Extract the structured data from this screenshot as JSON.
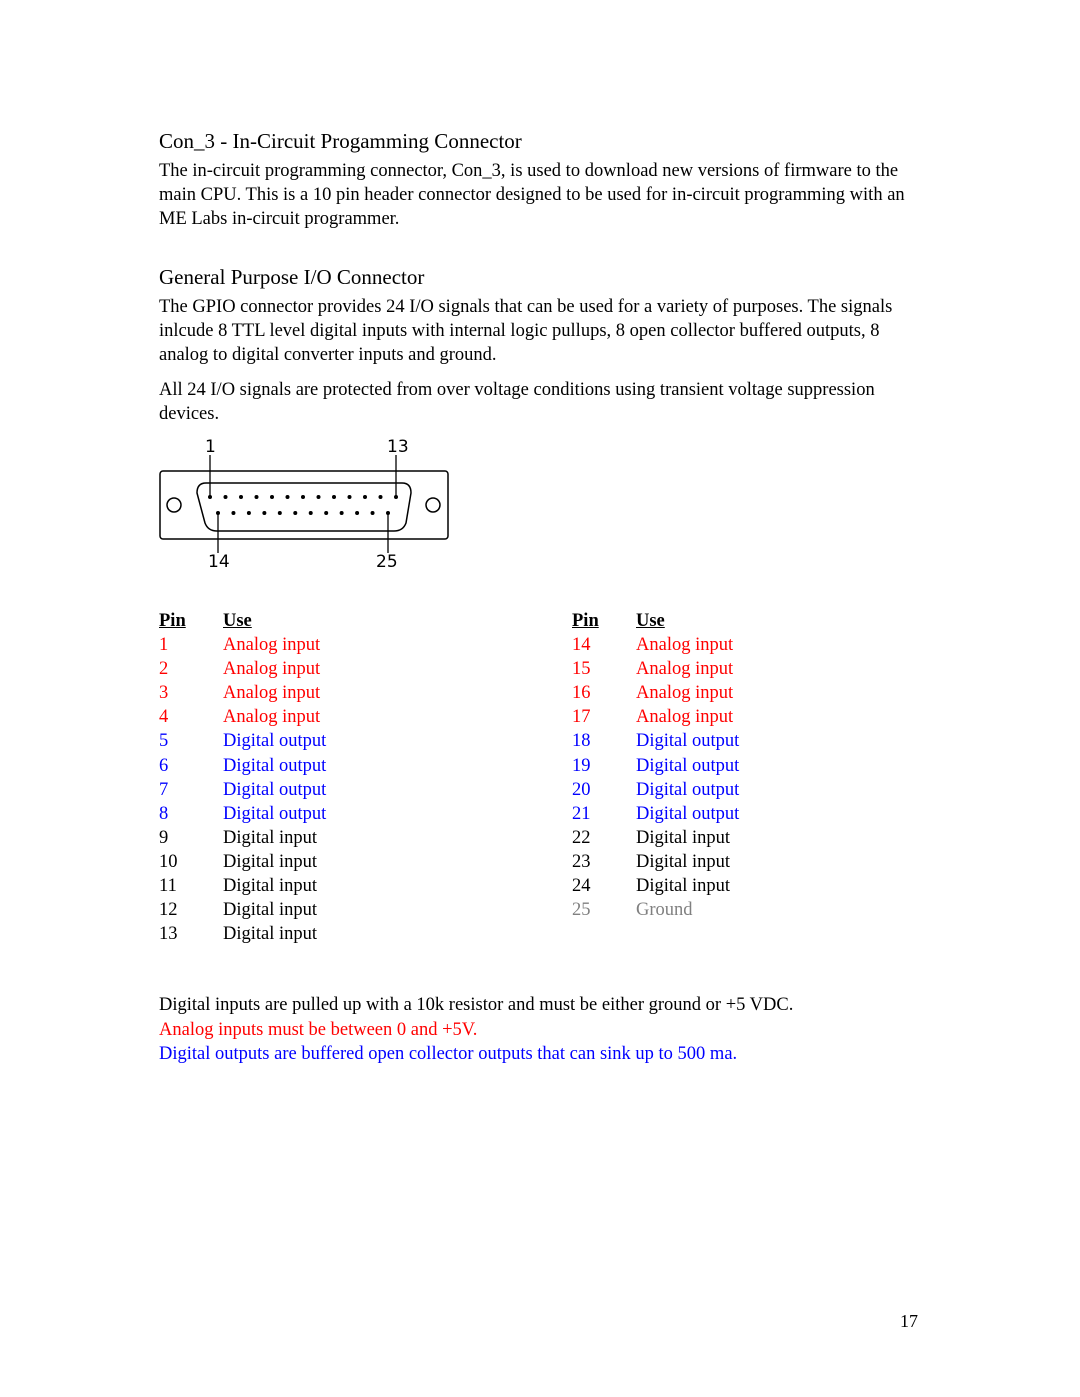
{
  "sections": [
    {
      "heading": "Con_3 - In-Circuit Progamming Connector",
      "paragraphs": [
        "The in-circuit programming connector, Con_3, is used to download new versions of firmware to the main CPU.  This is a 10 pin header connector designed to be used for in-circuit programming with an ME Labs in-circuit programmer."
      ]
    },
    {
      "heading": "General Purpose I/O Connector",
      "paragraphs": [
        "The GPIO connector provides 24 I/O signals that can be used for a variety of purposes. The signals inlcude 8 TTL level digital inputs with internal logic pullups, 8 open collector buffered outputs, 8 analog to digital converter inputs and ground.",
        "All 24 I/O signals are protected from over voltage conditions using transient voltage suppression devices."
      ]
    }
  ],
  "connector_diagram": {
    "labels": {
      "top_left": "1",
      "top_right": "13",
      "bottom_left": "14",
      "bottom_right": "25"
    },
    "top_row_pins": 13,
    "bottom_row_pins": 12
  },
  "pin_table": {
    "headers": {
      "pin": "Pin",
      "use": "Use"
    },
    "left": [
      {
        "pin": "1",
        "use": "Analog input",
        "type": "analog"
      },
      {
        "pin": "2",
        "use": "Analog input",
        "type": "analog"
      },
      {
        "pin": "3",
        "use": "Analog input",
        "type": "analog"
      },
      {
        "pin": "4",
        "use": "Analog input",
        "type": "analog"
      },
      {
        "pin": "5",
        "use": "Digital output",
        "type": "dout"
      },
      {
        "pin": "6",
        "use": "Digital output",
        "type": "dout"
      },
      {
        "pin": "7",
        "use": "Digital output",
        "type": "dout"
      },
      {
        "pin": "8",
        "use": "Digital output",
        "type": "dout"
      },
      {
        "pin": "9",
        "use": "Digital input",
        "type": "din"
      },
      {
        "pin": "10",
        "use": "Digital input",
        "type": "din"
      },
      {
        "pin": "11",
        "use": "Digital input",
        "type": "din"
      },
      {
        "pin": "12",
        "use": "Digital input",
        "type": "din"
      },
      {
        "pin": "13",
        "use": "Digital input",
        "type": "din"
      }
    ],
    "right": [
      {
        "pin": "14",
        "use": "Analog input",
        "type": "analog"
      },
      {
        "pin": "15",
        "use": "Analog input",
        "type": "analog"
      },
      {
        "pin": "16",
        "use": "Analog input",
        "type": "analog"
      },
      {
        "pin": "17",
        "use": "Analog input",
        "type": "analog"
      },
      {
        "pin": "18",
        "use": "Digital output",
        "type": "dout"
      },
      {
        "pin": "19",
        "use": "Digital output",
        "type": "dout"
      },
      {
        "pin": "20",
        "use": "Digital output",
        "type": "dout"
      },
      {
        "pin": "21",
        "use": "Digital output",
        "type": "dout"
      },
      {
        "pin": "22",
        "use": "Digital input",
        "type": "din"
      },
      {
        "pin": "23",
        "use": "Digital input",
        "type": "din"
      },
      {
        "pin": "24",
        "use": "Digital input",
        "type": "din"
      },
      {
        "pin": "25",
        "use": "Ground",
        "type": "ground"
      }
    ]
  },
  "notes": {
    "digital_inputs": "Digital inputs are pulled up with a 10k resistor and must be either ground or +5 VDC.",
    "analog_inputs": "Analog inputs must be between 0 and +5V.",
    "digital_outputs": "Digital outputs are buffered open collector outputs that can sink up to 500 ma."
  },
  "colors": {
    "analog": "#ff0000",
    "dout": "#0000ff",
    "din": "#000000",
    "ground": "#808080"
  },
  "page_number": "17"
}
